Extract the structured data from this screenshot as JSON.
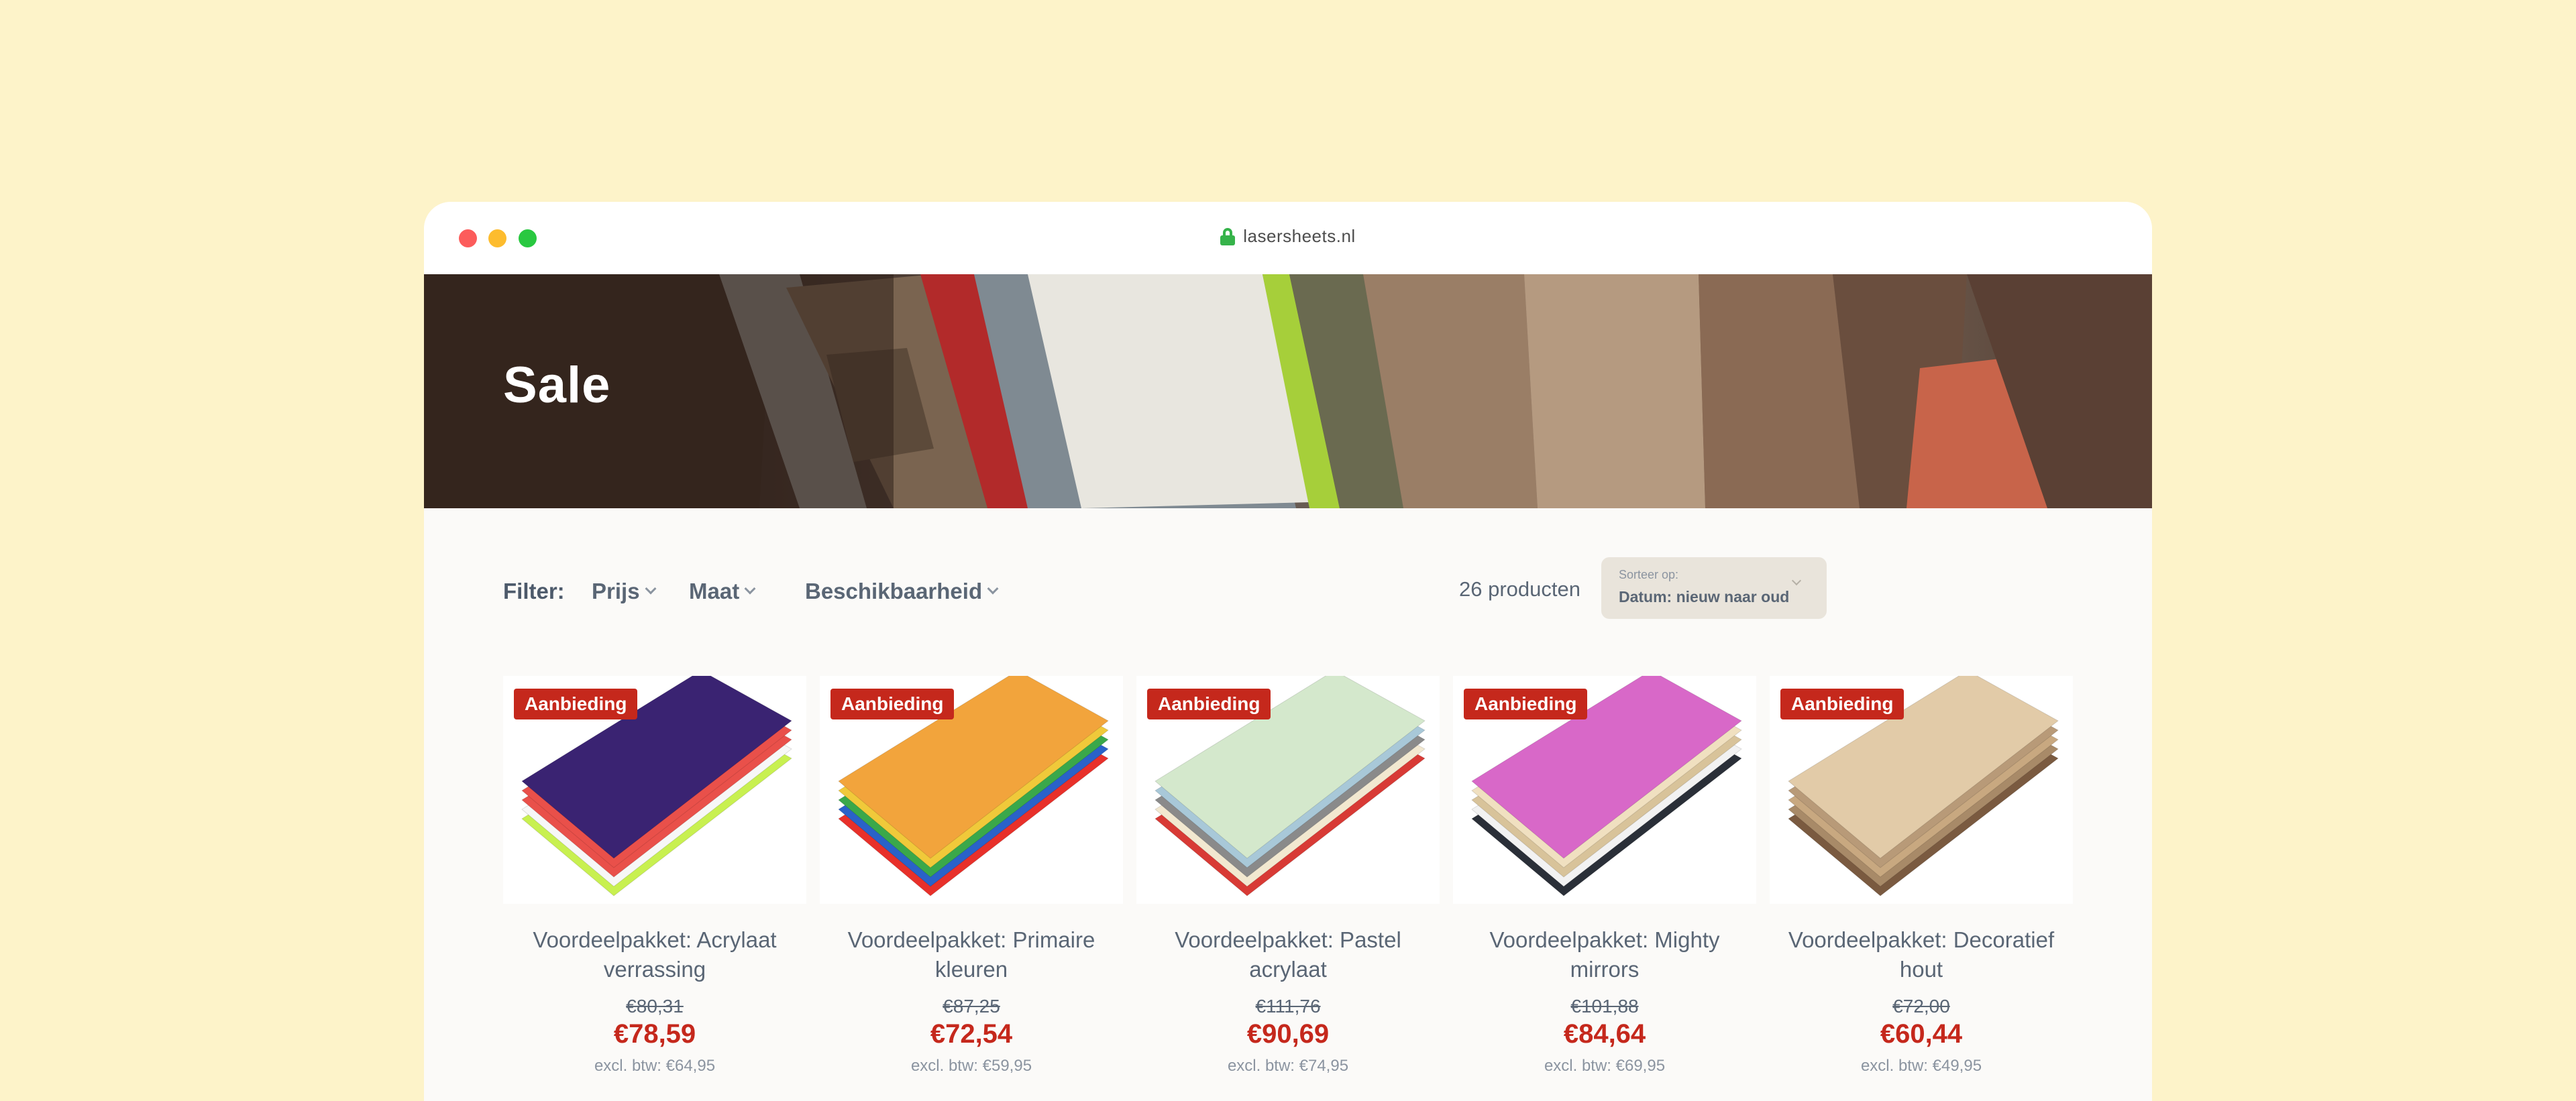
{
  "browser": {
    "url": "lasersheets.nl"
  },
  "hero": {
    "title": "Sale"
  },
  "filters": {
    "label": "Filter:",
    "items": [
      "Prijs",
      "Maat",
      "Beschikbaarheid"
    ],
    "count": "26 producten",
    "sort_label": "Sorteer op:",
    "sort_value": "Datum: nieuw naar oud"
  },
  "products": [
    {
      "badge": "Aanbieding",
      "name": "Voordeelpakket: Acrylaat verrassing",
      "old_price": "€80,31",
      "price": "€78,59",
      "excl": "excl. btw: €64,95",
      "colors": [
        "#c8f050",
        "#f7f7f7",
        "#e9504a",
        "#e9504a",
        "#3a2372"
      ]
    },
    {
      "badge": "Aanbieding",
      "name": "Voordeelpakket: Primaire kleuren",
      "old_price": "€87,25",
      "price": "€72,54",
      "excl": "excl. btw: €59,95",
      "colors": [
        "#e8302a",
        "#2a62c9",
        "#3aa84a",
        "#f0c93a",
        "#f2a43c"
      ]
    },
    {
      "badge": "Aanbieding",
      "name": "Voordeelpakket: Pastel acrylaat",
      "old_price": "€111,76",
      "price": "€90,69",
      "excl": "excl. btw: €74,95",
      "colors": [
        "#d83a35",
        "#f2e8d0",
        "#8a8a8a",
        "#a8c8d8",
        "#d4e8cc"
      ]
    },
    {
      "badge": "Aanbieding",
      "name": "Voordeelpakket: Mighty mirrors",
      "old_price": "€101,88",
      "price": "€84,64",
      "excl": "excl. btw: €69,95",
      "colors": [
        "#2a2f38",
        "#f2f2f2",
        "#d8c39a",
        "#f0e0c0",
        "#d868c8"
      ]
    },
    {
      "badge": "Aanbieding",
      "name": "Voordeelpakket: Decoratief hout",
      "old_price": "€72,00",
      "price": "€60,44",
      "excl": "excl. btw: €49,95",
      "colors": [
        "#7a5a40",
        "#a88a68",
        "#c8a880",
        "#b89a78",
        "#e2cba8"
      ]
    }
  ]
}
